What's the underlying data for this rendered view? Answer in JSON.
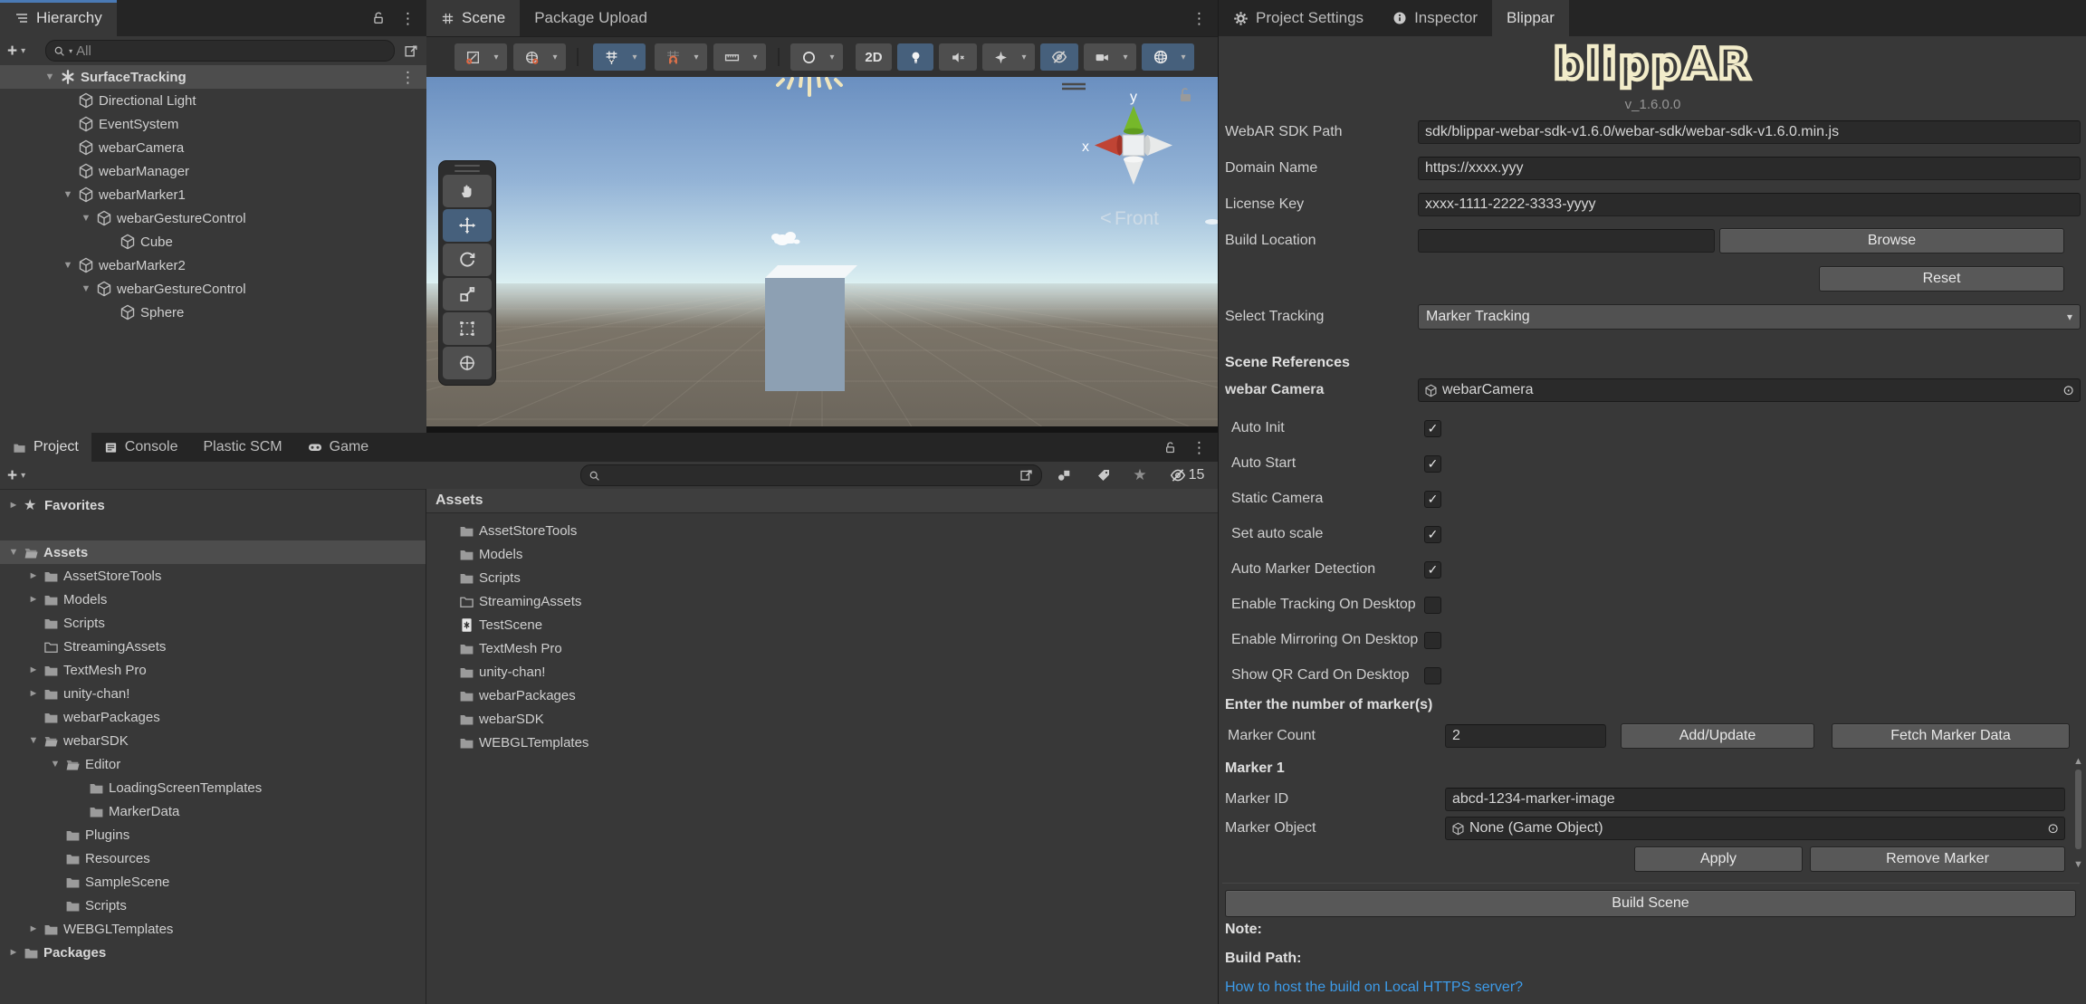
{
  "colors": {
    "accent_blue": "#46607c",
    "focus_blue": "#4a7ab5",
    "link_blue": "#3d9be9",
    "logo_cream": "#f2ecca",
    "magnet_orange": "#e0724a",
    "axis_green": "#76b82a",
    "axis_red": "#c04434",
    "selection_grey": "#4d4d4d"
  },
  "icons": {
    "caret_down": "▼",
    "caret_right": "►",
    "dropdown": "▾",
    "star": "★",
    "check": "✓",
    "picker": "⊙",
    "kebab": "⋮",
    "plus": "+",
    "scroll_up": "▲",
    "scroll_down": "▼",
    "chevron_left": "<"
  },
  "hierarchy": {
    "tab": "Hierarchy",
    "search_label": "All",
    "tree": [
      {
        "label": "SurfaceTracking"
      },
      {
        "label": "Directional Light"
      },
      {
        "label": "EventSystem"
      },
      {
        "label": "webarCamera"
      },
      {
        "label": "webarManager"
      },
      {
        "label": "webarMarker1"
      },
      {
        "label": "webarGestureControl"
      },
      {
        "label": "Cube"
      },
      {
        "label": "webarMarker2"
      },
      {
        "label": "webarGestureControl"
      },
      {
        "label": "Sphere"
      }
    ]
  },
  "scene": {
    "tab_scene": "Scene",
    "tab_package": "Package Upload",
    "btn_2d": "2D",
    "front_label": "Front",
    "axis_x": "x",
    "axis_y": "y"
  },
  "project": {
    "tabs": {
      "project": "Project",
      "console": "Console",
      "plastic": "Plastic SCM",
      "game": "Game"
    },
    "favorites": "Favorites",
    "hidden_count": "15",
    "tree": [
      {
        "label": "Assets"
      },
      {
        "label": "AssetStoreTools"
      },
      {
        "label": "Models"
      },
      {
        "label": "Scripts"
      },
      {
        "label": "StreamingAssets"
      },
      {
        "label": "TextMesh Pro"
      },
      {
        "label": "unity-chan!"
      },
      {
        "label": "webarPackages"
      },
      {
        "label": "webarSDK"
      },
      {
        "label": "Editor"
      },
      {
        "label": "LoadingScreenTemplates"
      },
      {
        "label": "MarkerData"
      },
      {
        "label": "Plugins"
      },
      {
        "label": "Resources"
      },
      {
        "label": "SampleScene"
      },
      {
        "label": "Scripts"
      },
      {
        "label": "WEBGLTemplates"
      },
      {
        "label": "Packages"
      }
    ],
    "assets_header": "Assets",
    "assets_list": [
      "AssetStoreTools",
      "Models",
      "Scripts",
      "StreamingAssets",
      "TestScene",
      "TextMesh Pro",
      "unity-chan!",
      "webarPackages",
      "webarSDK",
      "WEBGLTemplates"
    ]
  },
  "blippar": {
    "tab_settings": "Project Settings",
    "tab_inspector": "Inspector",
    "tab_blippar": "Blippar",
    "logo": "blippAR",
    "version": "v_1.6.0.0",
    "sdk_path_label": "WebAR SDK Path",
    "sdk_path_value": "sdk/blippar-webar-sdk-v1.6.0/webar-sdk/webar-sdk-v1.6.0.min.js",
    "domain_label": "Domain Name",
    "domain_value": "https://xxxx.yyy",
    "license_label": "License Key",
    "license_value": "xxxx-1111-2222-3333-yyyy",
    "build_location_label": "Build Location",
    "build_location_value": "",
    "browse": "Browse",
    "reset": "Reset",
    "select_tracking_label": "Select Tracking",
    "select_tracking_value": "Marker Tracking",
    "scene_references": "Scene References",
    "webar_camera_label": "webar Camera",
    "webar_camera_value": "webarCamera",
    "checks": [
      {
        "label": "Auto Init",
        "checked": true
      },
      {
        "label": "Auto Start",
        "checked": true
      },
      {
        "label": "Static Camera",
        "checked": true
      },
      {
        "label": "Set auto scale",
        "checked": true
      },
      {
        "label": "Auto Marker Detection",
        "checked": true
      },
      {
        "label": "Enable Tracking On Desktop",
        "checked": false
      },
      {
        "label": "Enable Mirroring On Desktop",
        "checked": false
      },
      {
        "label": "Show QR Card On Desktop",
        "checked": false
      }
    ],
    "marker_section": "Enter the number of marker(s)",
    "marker_count_label": "Marker Count",
    "marker_count_value": "2",
    "add_update": "Add/Update",
    "fetch": "Fetch Marker Data",
    "marker1": "Marker 1",
    "marker_id_label": "Marker ID",
    "marker_id_value": "abcd-1234-marker-image",
    "marker_object_label": "Marker Object",
    "marker_object_value": "None (Game Object)",
    "apply": "Apply",
    "remove": "Remove Marker",
    "build_scene": "Build Scene",
    "note": "Note:",
    "build_path": "Build Path:",
    "link": "How to host the build on Local HTTPS server?"
  }
}
